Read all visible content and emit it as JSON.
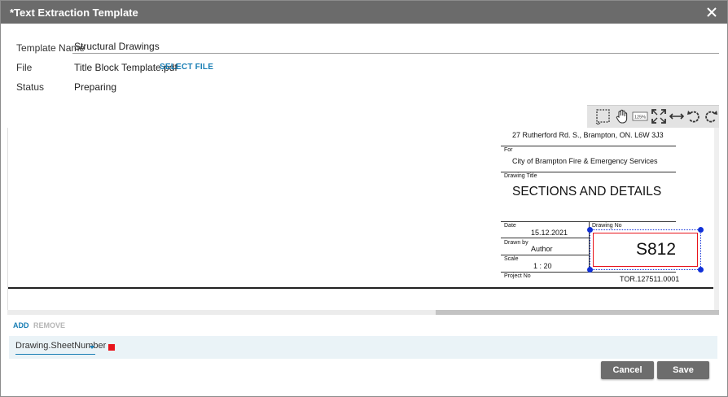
{
  "dialog": {
    "title": "*Text Extraction Template"
  },
  "form": {
    "template_name_label": "Template Name",
    "template_name_value": "Structural Drawings",
    "file_label": "File",
    "file_value": "Title Block Template.pdf",
    "select_file_label": "SELECT FILE",
    "status_label": "Status",
    "status_value": "Preparing"
  },
  "toolbar": {
    "icons": [
      "marquee-select-icon",
      "pan-hand-icon",
      "zoom-percent-icon",
      "fit-page-icon",
      "fit-width-icon",
      "rotate-left-icon",
      "rotate-right-icon"
    ],
    "zoom_text": "125%"
  },
  "document": {
    "address": "27 Rutherford Rd. S., Brampton, ON. L6W 3J3",
    "for_label": "For",
    "client": "City of Brampton Fire & Emergency Services",
    "drawing_title_label": "Drawing  Title",
    "drawing_title": "SECTIONS AND DETAILS",
    "date_label": "Date",
    "date_value": "15.12.2021",
    "drawing_no_label": "Drawing  No",
    "drawing_no_value": "S812",
    "drawn_by_label": "Drawn  by",
    "drawn_by_value": "Author",
    "scale_label": "Scale",
    "scale_value": "1 : 20",
    "project_no_label": "Project  No",
    "project_no_value": "TOR.127511.0001"
  },
  "fields_panel": {
    "add_label": "ADD",
    "remove_label": "REMOVE",
    "items": [
      {
        "field": "Drawing.SheetNumber",
        "color": "#e8141c"
      }
    ]
  },
  "actions": {
    "cancel_label": "Cancel",
    "save_label": "Save"
  },
  "colors": {
    "titlebar": "#6b6b6b",
    "accent": "#1a7fb5",
    "selection_red": "#e8141c",
    "handle_blue": "#1030d8",
    "button": "#6d6d6d"
  }
}
